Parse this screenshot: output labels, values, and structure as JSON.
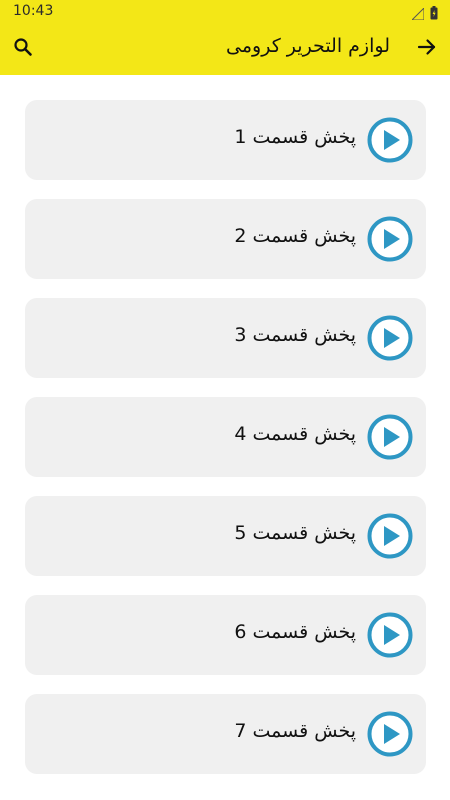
{
  "status_bar": {
    "time": "10:43"
  },
  "header": {
    "title": "لوازم التحریر کرومی"
  },
  "episodes": [
    {
      "label": "پخش قسمت 1"
    },
    {
      "label": "پخش قسمت 2"
    },
    {
      "label": "پخش قسمت 3"
    },
    {
      "label": "پخش قسمت 4"
    },
    {
      "label": "پخش قسمت 5"
    },
    {
      "label": "پخش قسمت 6"
    },
    {
      "label": "پخش قسمت 7"
    }
  ],
  "colors": {
    "header_bg": "#f3e717",
    "card_bg": "#f0f0f0",
    "play_accent": "#2e97c4"
  },
  "icons": {
    "search": "search-icon",
    "back": "arrow-forward-icon",
    "play": "play-circle-icon",
    "signal": "signal-icon",
    "battery": "battery-icon"
  }
}
